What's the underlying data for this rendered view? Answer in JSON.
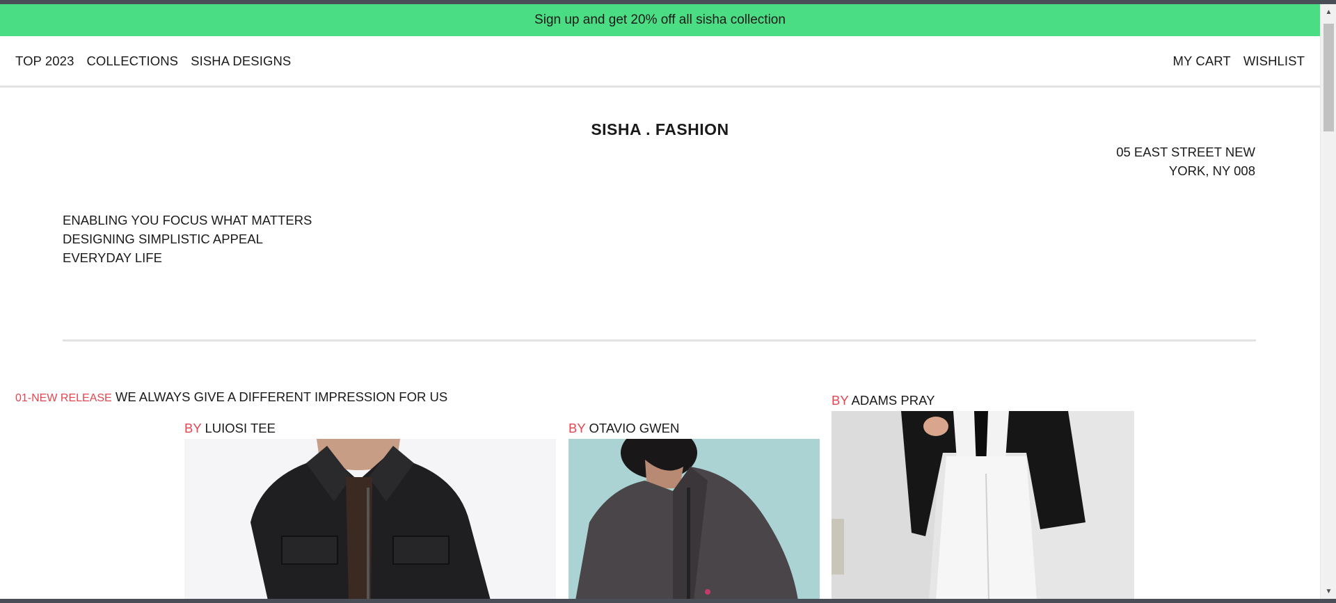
{
  "promo": {
    "text": "Sign up and get 20% off all sisha collection"
  },
  "nav": {
    "left": [
      {
        "label": "TOP 2023"
      },
      {
        "label": "COLLECTIONS"
      },
      {
        "label": "SISHA DESIGNS"
      }
    ],
    "right": [
      {
        "label": "MY CART"
      },
      {
        "label": "WISHLIST"
      }
    ]
  },
  "brand": {
    "title": "SISHA . FASHION"
  },
  "address": {
    "line1": "05 EAST STREET NEW",
    "line2": "YORK, NY 008"
  },
  "tagline": {
    "line1": "ENABLING YOU FOCUS WHAT MATTERS",
    "line2": "DESIGNING SIMPLISTIC APPEAL",
    "line3": "EVERYDAY LIFE"
  },
  "release": {
    "number": "01-NEW RELEASE",
    "headline": "WE ALWAYS GIVE A DIFFERENT IMPRESSION FOR US"
  },
  "products": [
    {
      "by": "BY",
      "designer": "LUIOSI TEE",
      "image": "black-jacket-photo"
    },
    {
      "by": "BY",
      "designer": "OTAVIO GWEN",
      "image": "fleece-jacket-photo"
    },
    {
      "by": "BY",
      "designer": "ADAMS PRAY",
      "image": "white-suit-photo"
    }
  ],
  "colors": {
    "promo_bg": "#4bdd83",
    "accent_red": "#e4454f"
  }
}
